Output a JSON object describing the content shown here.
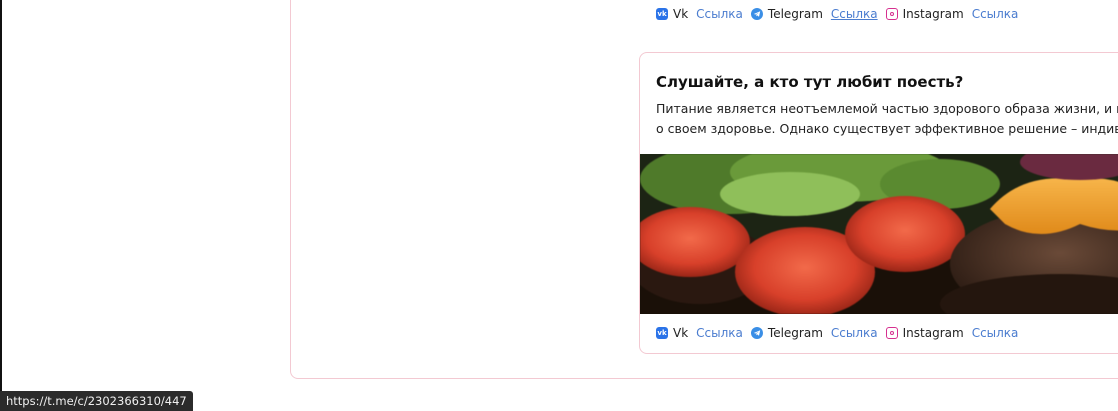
{
  "social_top": {
    "vk_label": "Vk",
    "vk_link": "Ссылка",
    "telegram_label": "Telegram",
    "telegram_link": "Ссылка",
    "instagram_label": "Instagram",
    "instagram_link": "Ссылка"
  },
  "post": {
    "title": "Слушайте, а кто тут любит поесть?",
    "text_line1": "Питание является неотъемлемой частью здорового образа жизни, и мн",
    "text_line2": "о своем здоровье. Однако существует эффективное решение – индивид",
    "image": "burger-photo",
    "social": {
      "vk_label": "Vk",
      "vk_link": "Ссылка",
      "telegram_label": "Telegram",
      "telegram_link": "Ссылка",
      "instagram_label": "Instagram",
      "instagram_link": "Ссылка"
    }
  },
  "status_bar": {
    "url": "https://t.me/c/2302366310/447"
  },
  "colors": {
    "accent_link": "#4a7ccf",
    "card_border": "#f3c9d2",
    "vk": "#2b73e8",
    "telegram": "#3a8ee6",
    "instagram": "#d62f8f"
  }
}
